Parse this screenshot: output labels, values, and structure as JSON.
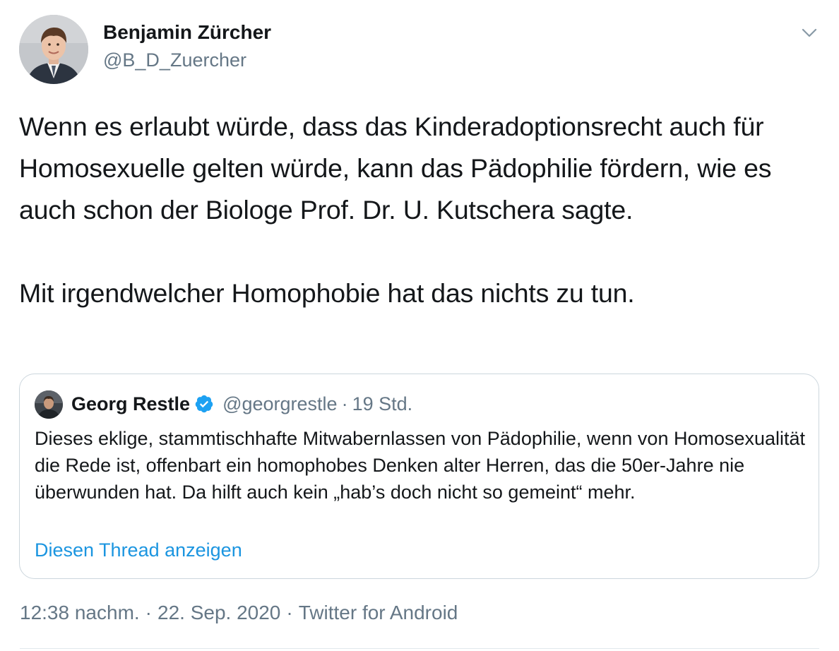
{
  "author": {
    "name": "Benjamin Zürcher",
    "handle": "@B_D_Zuercher"
  },
  "tweet": {
    "paragraphs": [
      "Wenn es erlaubt würde, dass das Kinderadoptionsrecht auch für Homosexuelle gelten würde, kann das Pädophilie fördern, wie es auch schon der Biologe Prof. Dr. U. Kutschera sagte.",
      "Mit irgendwelcher Homophobie hat das nichts zu tun."
    ]
  },
  "quoted_tweet": {
    "name": "Georg Restle",
    "verified": true,
    "handle": "@georgrestle",
    "separator": "·",
    "time": "19 Std.",
    "text": "Dieses eklige, stammtischhafte Mitwabernlassen von Pädophilie, wenn von Homosexualität die Rede ist, offenbart ein homophobes Denken alter Herren, das die 50er-Jahre nie überwunden hat. Da hilft auch kein „hab’s doch nicht so gemeint“ mehr.",
    "thread_link": "Diesen Thread anzeigen"
  },
  "footer": {
    "time": "12:38 nachm.",
    "separator": "·",
    "date": "22. Sep. 2020",
    "source": "Twitter for Android"
  },
  "icons": {
    "caret": "chevron-down-icon",
    "verified": "verified-badge-icon"
  },
  "colors": {
    "text_primary": "#14171a",
    "text_secondary": "#657786",
    "link": "#1b95e0",
    "verified": "#1da1f2",
    "border": "#ccd6dd"
  }
}
